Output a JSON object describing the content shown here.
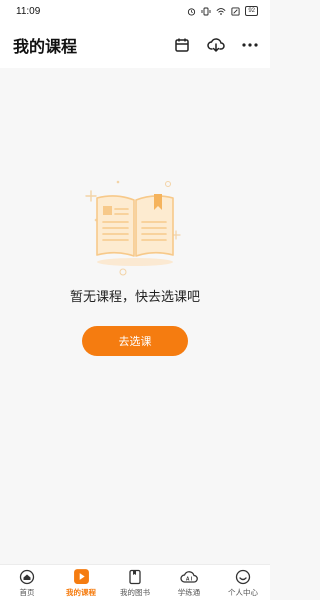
{
  "status_bar": {
    "time": "11:09",
    "battery": "92"
  },
  "header": {
    "title": "我的课程"
  },
  "empty_state": {
    "message": "暂无课程，快去选课吧",
    "button_label": "去选课"
  },
  "tabs": [
    {
      "label": "首页",
      "icon": "home-icon",
      "active": false
    },
    {
      "label": "我的课程",
      "icon": "play-icon",
      "active": true
    },
    {
      "label": "我的图书",
      "icon": "book-icon",
      "active": false
    },
    {
      "label": "学练通",
      "icon": "ai-cloud-icon",
      "active": false
    },
    {
      "label": "个人中心",
      "icon": "smile-icon",
      "active": false
    }
  ],
  "colors": {
    "accent": "#f57c10",
    "illustration": "#f7c98a",
    "background": "#f7f7f7"
  }
}
